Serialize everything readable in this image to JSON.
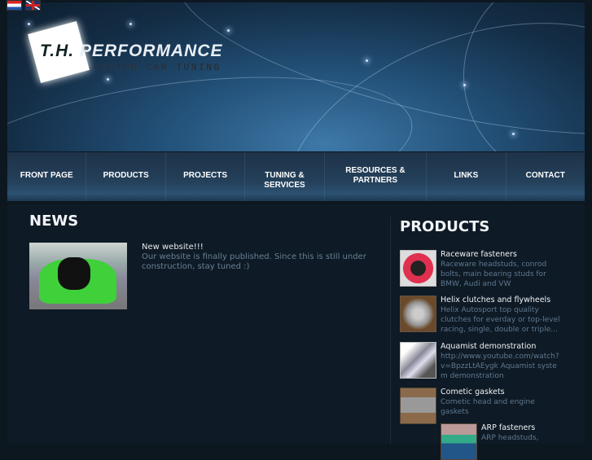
{
  "languages": [
    {
      "name": "Croatian"
    },
    {
      "name": "English"
    }
  ],
  "logo": {
    "brand_initials": "T.H.",
    "brand_name": "PERFORMANCE",
    "tagline": "CUSTOM CAR TUNING"
  },
  "nav": [
    "FRONT PAGE",
    "PRODUCTS",
    "PROJECTS",
    "TUNING & SERVICES",
    "RESOURCES & PARTNERS",
    "LINKS",
    "CONTACT"
  ],
  "news": {
    "title": "NEWS",
    "items": [
      {
        "headline": "New website!!!",
        "body": "Our website is finally published. Since this is still under construction, stay tuned :)"
      }
    ]
  },
  "products": {
    "title": "PRODUCTS",
    "items": [
      {
        "name": "Raceware fasteners",
        "desc": "Raceware headstuds, conrod bolts, main bearing studs for BMW, Audi and VW"
      },
      {
        "name": "Helix clutches and flywheels",
        "desc": "Helix Autosport top quality clutches for everday or top-level racing, single, double or triple..."
      },
      {
        "name": "Aquamist demonstration",
        "desc": "http://www.youtube.com/watch?v=BpzzLtAEygk   Aquamist system demonstration"
      },
      {
        "name": "Cometic gaskets",
        "desc": "Cometic head and engine gaskets"
      },
      {
        "name": "ARP fasteners",
        "desc": "ARP headstuds,"
      }
    ]
  }
}
